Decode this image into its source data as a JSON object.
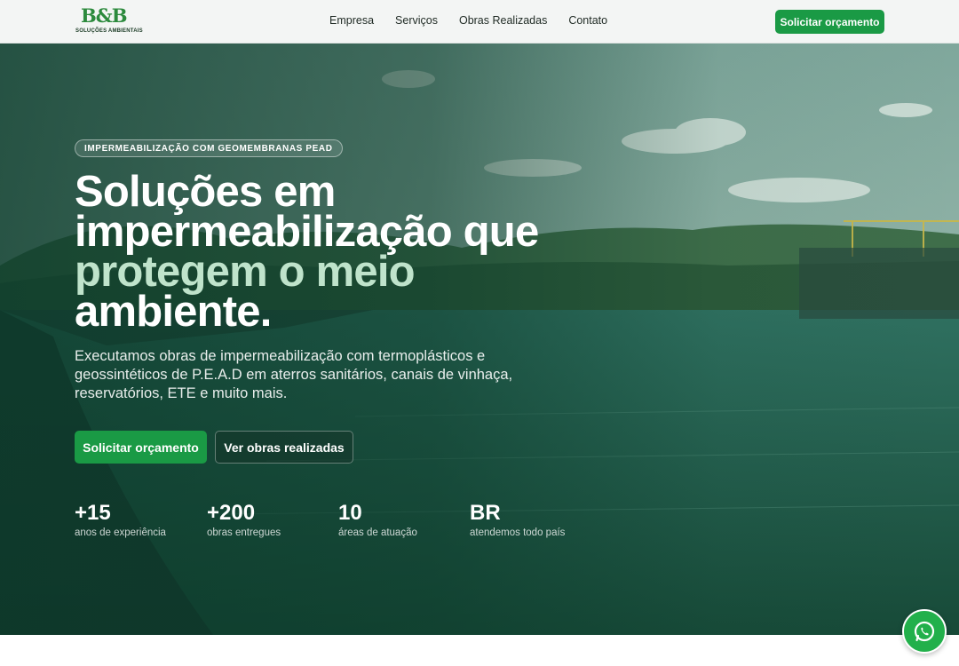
{
  "header": {
    "logo_mark": "B&B",
    "logo_subtitle": "SOLUÇÕES AMBIENTAIS",
    "nav": [
      {
        "label": "Empresa"
      },
      {
        "label": "Serviços"
      },
      {
        "label": "Obras Realizadas"
      },
      {
        "label": "Contato"
      }
    ],
    "cta_label": "Solicitar orçamento"
  },
  "hero": {
    "badge": "IMPERMEABILIZAÇÃO COM GEOMEMBRANAS PEAD",
    "headline_line1": "Soluções em",
    "headline_line2": "impermeabilização que",
    "headline_accent": "protegem o meio",
    "headline_line4": "ambiente.",
    "lead": "Executamos obras de impermeabilização com termoplásticos e geossintéticos de P.E.A.D em aterros sanitários, canais de vinhaça, reservatórios, ETE e muito mais.",
    "primary_button": "Solicitar orçamento",
    "secondary_button": "Ver obras realizadas",
    "stats": [
      {
        "value": "+15",
        "label": "anos de experiência"
      },
      {
        "value": "+200",
        "label": "obras entregues"
      },
      {
        "value": "10",
        "label": "áreas de atuação"
      },
      {
        "value": "BR",
        "label": "atendemos todo país"
      }
    ]
  },
  "colors": {
    "brand_green": "#1a9a45",
    "hero_overlay": "#0c3a2a",
    "accent_text": "#bfe3cb"
  },
  "floating": {
    "icon": "whatsapp-icon"
  }
}
